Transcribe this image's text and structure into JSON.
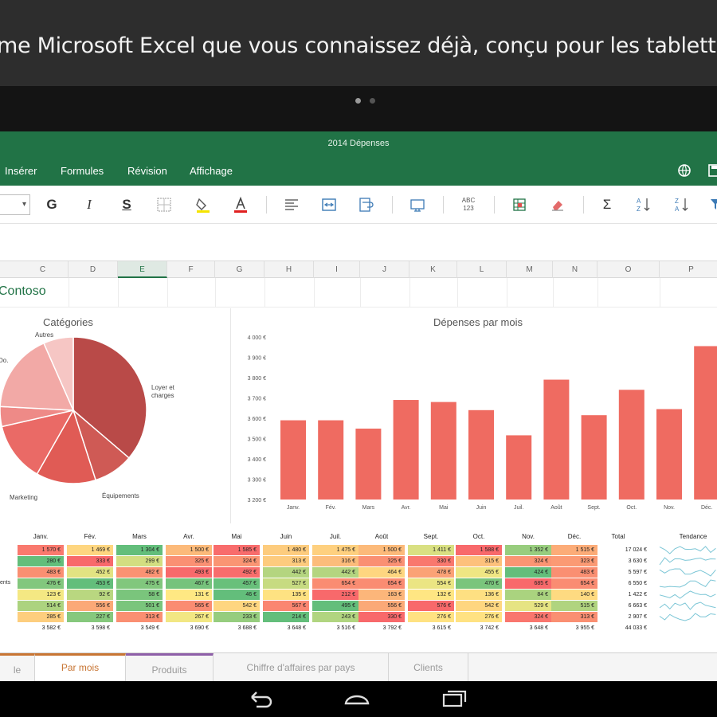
{
  "promo": {
    "headline": "me Microsoft Excel que vous connaissez déjà, conçu pour les tablettes",
    "page_dots": 2
  },
  "app": {
    "window_title": "2014 Dépenses",
    "menu": [
      "Insérer",
      "Formules",
      "Révision",
      "Affichage"
    ],
    "accent_color": "#217346"
  },
  "toolbar": {
    "bold": "G",
    "italic": "I",
    "underline": "S"
  },
  "columns": [
    "C",
    "D",
    "E",
    "F",
    "G",
    "H",
    "I",
    "J",
    "K",
    "L",
    "M",
    "N",
    "O",
    "P"
  ],
  "selected_column": "E",
  "sheet_heading": "Contoso",
  "chart_data": [
    {
      "type": "pie",
      "title": "Catégories",
      "labels": [
        "Loyer et charges",
        "Équipements",
        "Marketing",
        "",
        "",
        "Do.",
        "Autres"
      ],
      "values": [
        33,
        8,
        12,
        12,
        4,
        16,
        6
      ],
      "colors": [
        "#b94a48",
        "#cf5a55",
        "#e05b55",
        "#ea6a66",
        "#ee8a87",
        "#f2a9a6",
        "#f6c6c4"
      ]
    },
    {
      "type": "bar",
      "title": "Dépenses par mois",
      "categories": [
        "Janv.",
        "Fév.",
        "Mars",
        "Avr.",
        "Mai",
        "Juin",
        "Juil.",
        "Août",
        "Sept.",
        "Oct.",
        "Nov.",
        "Déc."
      ],
      "values": [
        3590,
        3590,
        3549,
        3690,
        3680,
        3640,
        3516,
        3790,
        3615,
        3740,
        3645,
        3955
      ],
      "ylim": [
        3200,
        4000
      ],
      "yticks": [
        "3 200 €",
        "3 300 €",
        "3 400 €",
        "3 500 €",
        "3 600 €",
        "3 700 €",
        "3 800 €",
        "3 900 €",
        "4 000 €"
      ],
      "bar_color": "#ef6b61",
      "grid": false
    }
  ],
  "table": {
    "headers": [
      "Janv.",
      "Fév.",
      "Mars",
      "Avr.",
      "Mai",
      "Juin",
      "Juil.",
      "Août",
      "Sept.",
      "Oct.",
      "Nov.",
      "Déc.",
      "Total",
      "Tendance"
    ],
    "row_labels": [
      "",
      "",
      "",
      "ents",
      "",
      "",
      "",
      ""
    ],
    "rows": [
      [
        "1 570 €",
        "1 469 €",
        "1 304 €",
        "1 500 €",
        "1 585 €",
        "1 480 €",
        "1 475 €",
        "1 500 €",
        "1 411 €",
        "1 588 €",
        "1 352 €",
        "1 515 €",
        "17 024 €"
      ],
      [
        "280 €",
        "333 €",
        "299 €",
        "325 €",
        "324 €",
        "313 €",
        "316 €",
        "325 €",
        "330 €",
        "315 €",
        "324 €",
        "323 €",
        "3 630 €"
      ],
      [
        "483 €",
        "452 €",
        "482 €",
        "493 €",
        "492 €",
        "442 €",
        "442 €",
        "464 €",
        "478 €",
        "455 €",
        "424 €",
        "483 €",
        "5 597 €"
      ],
      [
        "476 €",
        "453 €",
        "475 €",
        "467 €",
        "457 €",
        "527 €",
        "654 €",
        "654 €",
        "554 €",
        "470 €",
        "685 €",
        "654 €",
        "6 550 €"
      ],
      [
        "123 €",
        "92 €",
        "58 €",
        "131 €",
        "46 €",
        "135 €",
        "212 €",
        "163 €",
        "132 €",
        "136 €",
        "84 €",
        "140 €",
        "1 422 €"
      ],
      [
        "514 €",
        "556 €",
        "501 €",
        "565 €",
        "542 €",
        "567 €",
        "495 €",
        "556 €",
        "576 €",
        "542 €",
        "529 €",
        "515 €",
        "6 663 €"
      ],
      [
        "285 €",
        "227 €",
        "313 €",
        "267 €",
        "233 €",
        "214 €",
        "243 €",
        "330 €",
        "276 €",
        "276 €",
        "324 €",
        "313 €",
        "2 907 €"
      ],
      [
        "3 582 €",
        "3 598 €",
        "3 549 €",
        "3 690 €",
        "3 688 €",
        "3 648 €",
        "3 516 €",
        "3 792 €",
        "3 615 €",
        "3 742 €",
        "3 648 €",
        "3 955 €",
        "44 033 €"
      ]
    ]
  },
  "sheet_tabs": [
    {
      "label": "le",
      "active": false,
      "accent": "#c87533"
    },
    {
      "label": "Par mois",
      "active": true,
      "accent": "#c87533"
    },
    {
      "label": "Produits",
      "active": false,
      "accent": "#8e5fa8"
    },
    {
      "label": "Chiffre d'affaires par pays",
      "active": false,
      "accent": ""
    },
    {
      "label": "Clients",
      "active": false,
      "accent": ""
    }
  ]
}
